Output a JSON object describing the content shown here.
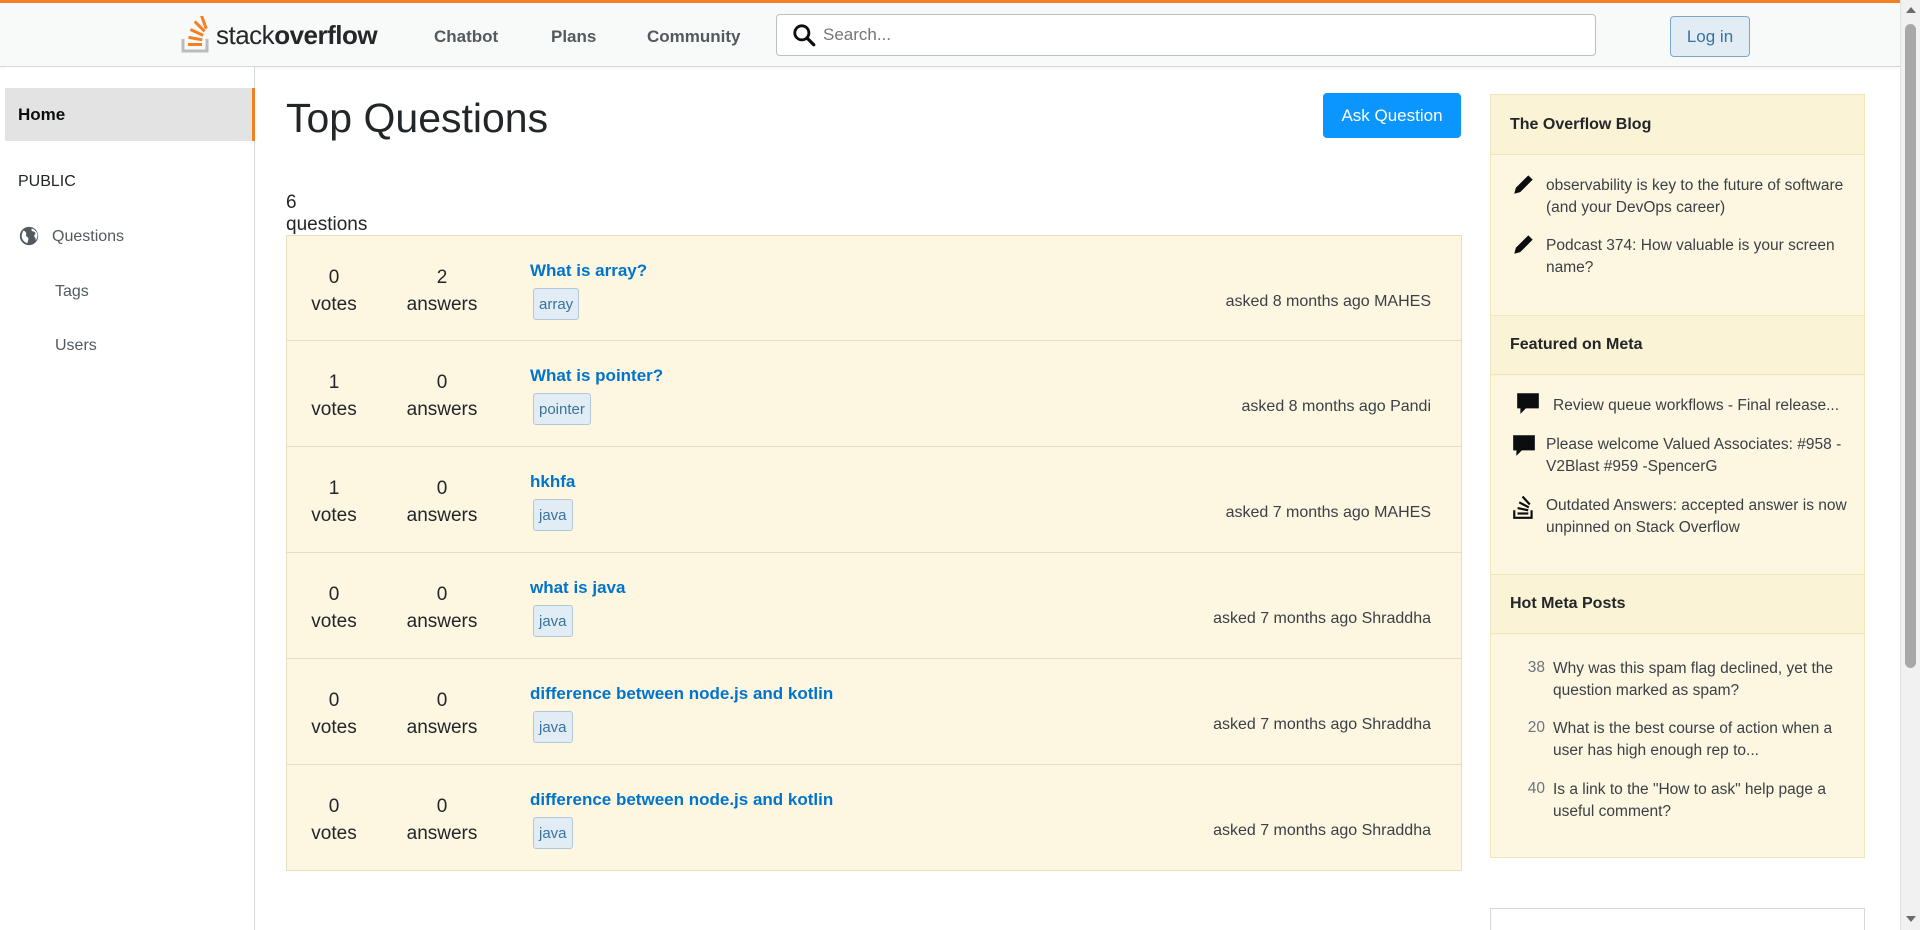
{
  "header": {
    "logo_light": "stack",
    "logo_bold": "overflow",
    "nav": [
      "Chatbot",
      "Plans",
      "Community"
    ],
    "search_placeholder": "Search...",
    "login_label": "Log in"
  },
  "sidebar": {
    "home": "Home",
    "section": "PUBLIC",
    "items": [
      "Questions",
      "Tags",
      "Users"
    ]
  },
  "main": {
    "title": "Top Questions",
    "ask_label": "Ask Question",
    "count": "6 questions",
    "questions": [
      {
        "votes": "0",
        "votes_label": "votes",
        "answers": "2",
        "answers_label": "answers",
        "title": "What is array?",
        "tag": "array",
        "meta": "asked 8 months ago MAHES"
      },
      {
        "votes": "1",
        "votes_label": "votes",
        "answers": "0",
        "answers_label": "answers",
        "title": "What is pointer?",
        "tag": "pointer",
        "meta": "asked 8 months ago Pandi"
      },
      {
        "votes": "1",
        "votes_label": "votes",
        "answers": "0",
        "answers_label": "answers",
        "title": "hkhfa",
        "tag": "java",
        "meta": "asked 7 months ago MAHES"
      },
      {
        "votes": "0",
        "votes_label": "votes",
        "answers": "0",
        "answers_label": "answers",
        "title": "what is java",
        "tag": "java",
        "meta": "asked 7 months ago Shraddha"
      },
      {
        "votes": "0",
        "votes_label": "votes",
        "answers": "0",
        "answers_label": "answers",
        "title": "difference between node.js and kotlin",
        "tag": "java",
        "meta": "asked 7 months ago Shraddha"
      },
      {
        "votes": "0",
        "votes_label": "votes",
        "answers": "0",
        "answers_label": "answers",
        "title": "difference between node.js and kotlin",
        "tag": "java",
        "meta": "asked 7 months ago Shraddha"
      }
    ]
  },
  "right": {
    "blog_title": "The Overflow Blog",
    "blog_items": [
      "observability is key to the future of software (and your DevOps career)",
      "Podcast 374: How valuable is your screen name?"
    ],
    "meta_title": "Featured on Meta",
    "meta_items": [
      "Review queue workflows - Final release...",
      "Please welcome Valued Associates: #958 - V2Blast #959 -SpencerG",
      "Outdated Answers: accepted answer is now unpinned on Stack Overflow"
    ],
    "hot_title": "Hot Meta Posts",
    "hot_items": [
      {
        "num": "38",
        "text": "Why was this spam flag declined, yet the question marked as spam?"
      },
      {
        "num": "20",
        "text": "What is the best course of action when a user has high enough rep to..."
      },
      {
        "num": "40",
        "text": "Is a link to the \"How to ask\" help page a useful comment?"
      }
    ]
  },
  "colors": {
    "accent": "#f48024",
    "link": "#0074cc",
    "ask_button": "#0a95ff",
    "question_bg": "#fdf7e2",
    "sidebar_panel_bg": "#fbf3d5"
  }
}
